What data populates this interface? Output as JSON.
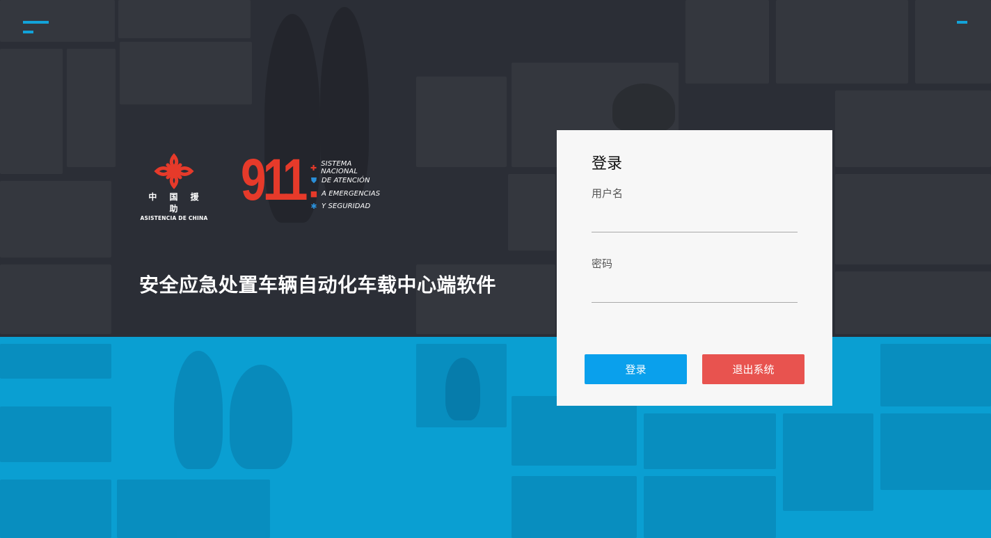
{
  "app": {
    "title": "安全应急处置车辆自动化车载中心端软件"
  },
  "logos": {
    "china_aid_cn": "中 国 援 助",
    "china_aid_en": "ASISTENCIA DE CHINA",
    "emergency_number": "911",
    "system_lines": [
      "SISTEMA NACIONAL",
      "DE ATENCIÓN",
      "A EMERGENCIAS",
      "Y SEGURIDAD"
    ]
  },
  "login": {
    "title": "登录",
    "username_label": "用户名",
    "username_value": "",
    "password_label": "密码",
    "password_value": "",
    "login_button": "登录",
    "exit_button": "退出系统"
  },
  "colors": {
    "accent": "#12a3d9",
    "primary_button": "#0aa0ec",
    "danger_button": "#e8534f",
    "logo_red": "#e63a2a"
  }
}
